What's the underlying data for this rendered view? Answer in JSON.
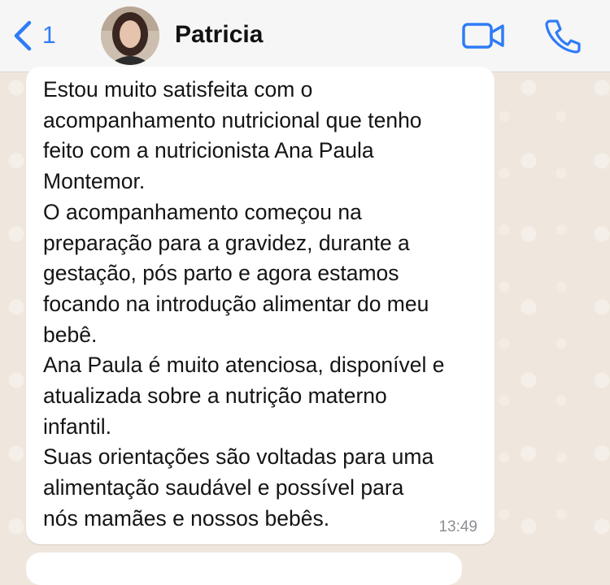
{
  "header": {
    "back_count": "1",
    "contact_name": "Patricia"
  },
  "icons": {
    "back": "chevron-left-icon",
    "video": "video-camera-icon",
    "call": "phone-icon"
  },
  "colors": {
    "accent": "#2f7cf6",
    "header_bg": "#f6f6f6",
    "chat_bg": "#efe7dd",
    "bubble_bg": "#ffffff",
    "timestamp": "#8e8e93"
  },
  "message": {
    "lines": [
      "Estou muito satisfeita com o",
      "acompanhamento nutricional que tenho",
      "feito com a nutricionista Ana Paula",
      "Montemor.",
      "O acompanhamento começou na",
      "preparação para a gravidez, durante a",
      "gestação, pós parto e agora estamos",
      "focando na introdução alimentar do meu",
      "bebê.",
      "Ana Paula é muito atenciosa, disponível e",
      "atualizada sobre a nutrição materno",
      "infantil.",
      "Suas orientações são voltadas para uma",
      "alimentação saudável  e possível para",
      "nós mamães e nossos bebês."
    ],
    "time": "13:49"
  }
}
